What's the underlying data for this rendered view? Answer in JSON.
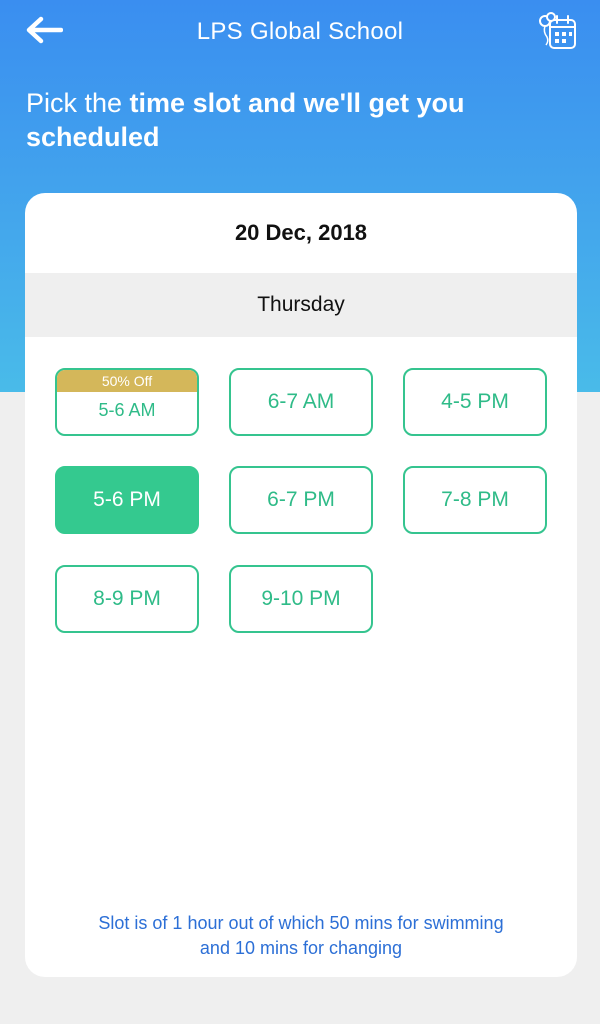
{
  "header": {
    "title": "LPS Global School",
    "back_icon": "arrow-left-icon",
    "calendar_icon": "calendar-balloons-icon"
  },
  "headline": {
    "prefix": "Pick the ",
    "bold": "time slot and we'll get you scheduled"
  },
  "schedule": {
    "date": "20 Dec, 2018",
    "day": "Thursday"
  },
  "slots": [
    {
      "label": "5-6 AM",
      "badge": "50% Off",
      "selected": false
    },
    {
      "label": "6-7 AM",
      "selected": false
    },
    {
      "label": "4-5 PM",
      "selected": false
    },
    {
      "label": "5-6 PM",
      "selected": true
    },
    {
      "label": "6-7 PM",
      "selected": false
    },
    {
      "label": "7-8 PM",
      "selected": false
    },
    {
      "label": "8-9 PM",
      "selected": false
    },
    {
      "label": "9-10 PM",
      "selected": false
    }
  ],
  "footnote": {
    "line1": "Slot is of 1 hour out of which 50 mins for swimming",
    "line2": "and 10 mins for changing"
  },
  "colors": {
    "brand_blue": "#3a8ef0",
    "slot_green": "#34c98f",
    "badge_gold": "#d4b75a",
    "note_blue": "#2c6fd6"
  }
}
